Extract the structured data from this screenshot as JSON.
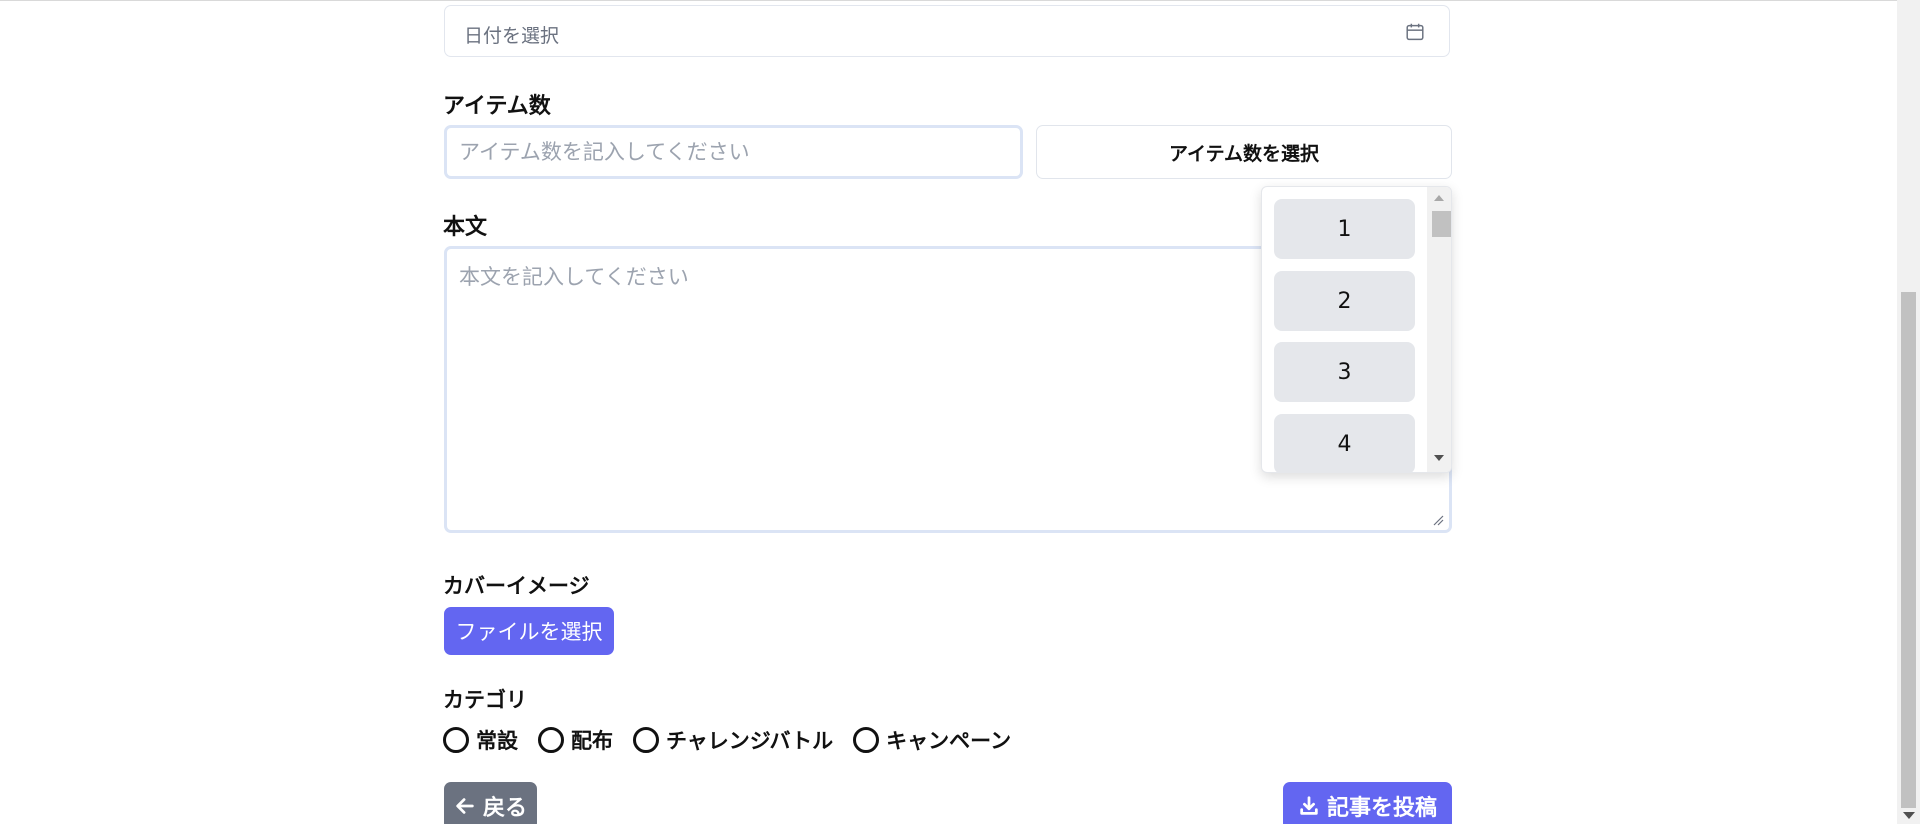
{
  "form": {
    "date_placeholder": "日付を選択",
    "items_label": "アイテム数",
    "items_placeholder": "アイテム数を記入してください",
    "items_select_label": "アイテム数を選択",
    "body_label": "本文",
    "body_placeholder": "本文を記入してください",
    "cover_label": "カバーイメージ",
    "file_button_label": "ファイルを選択",
    "category_label": "カテゴリ",
    "categories": [
      "常設",
      "配布",
      "チャレンジバトル",
      "キャンペーン"
    ],
    "back_label": "戻る",
    "submit_label": "記事を投稿"
  },
  "dropdown": {
    "options": [
      "1",
      "2",
      "3",
      "4"
    ]
  },
  "colors": {
    "primary": "#6366f1",
    "secondary": "#6b7280",
    "option_background": "#e5e7eb",
    "input_border": "#dbe4f5"
  },
  "icons": {
    "calendar": "calendar-icon",
    "back": "arrow-left-icon",
    "submit": "download-icon"
  }
}
